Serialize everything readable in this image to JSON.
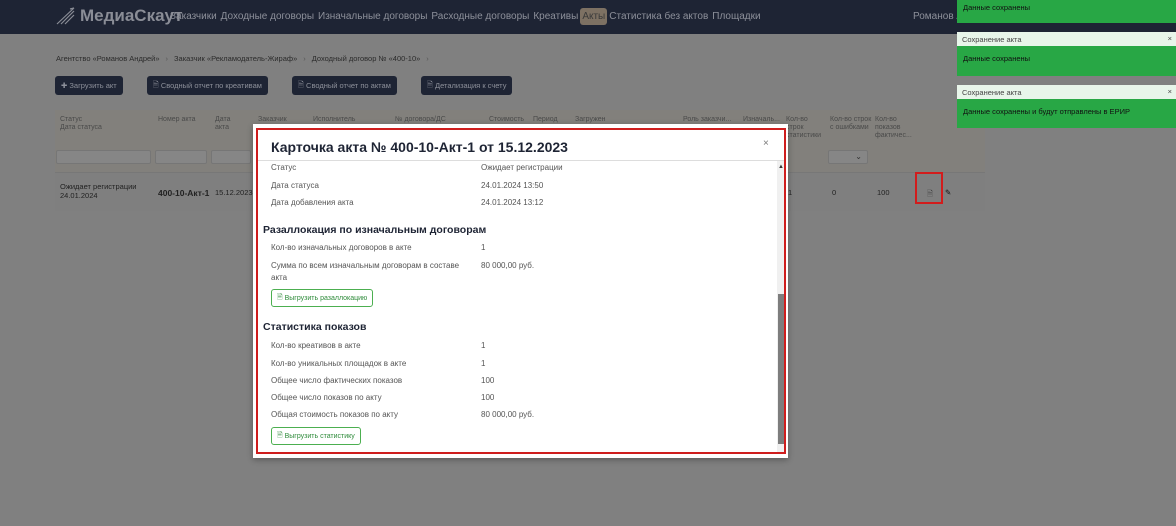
{
  "nav": {
    "brand": "МедиаСкаут",
    "items": [
      "Заказчики",
      "Доходные договоры",
      "Изначальные договоры",
      "Расходные договоры",
      "Креативы",
      "Акты",
      "Статистика без актов",
      "Площадки"
    ],
    "active": "Акты",
    "user": "Романов А"
  },
  "breadcrumb": [
    "Агентство «Романов Андрей»",
    "Заказчик «Рекламодатель-Жираф»",
    "Доходный договор № «400-10»"
  ],
  "toolbar": {
    "upload": "Загрузить акт",
    "report_creatives": "Сводный отчет по креативам",
    "report_acts": "Сводный отчет по актам",
    "detail": "Детализация к счету"
  },
  "table": {
    "headers": [
      "Статус\nДата статуса",
      "Номер акта",
      "Дата акта",
      "Заказчик",
      "Исполнитель",
      "№ договора/ДС",
      "Стоимость",
      "Период",
      "Загружен",
      "Роль заказчи...",
      "Изначаль...",
      "Кол-во строк статистики",
      "Кол-во строк с ошибками",
      "Кол-во показов фактичес..."
    ],
    "row": {
      "status": "Ожидает регистрации",
      "status_date": "24.01.2024",
      "number": "400-10-Акт-1",
      "date": "15.12.2023",
      "rows_stat": "1",
      "rows_errors": "0",
      "shows": "100"
    }
  },
  "modal": {
    "title": "Карточка акта № 400-10-Акт-1 от 15.12.2023",
    "close": "×",
    "general": [
      {
        "k": "Статус",
        "v": "Ожидает регистрации"
      },
      {
        "k": "Дата статуса",
        "v": "24.01.2024 13:50"
      },
      {
        "k": "Дата добавления акта",
        "v": "24.01.2024 13:12"
      }
    ],
    "realloc": {
      "title": "Разаллокация по изначальным договорам",
      "items": [
        {
          "k": "Кол-во изначальных договоров в акте",
          "v": "1"
        },
        {
          "k": "Сумма по всем изначальным договорам в составе акта",
          "v": "80 000,00 руб."
        }
      ],
      "button": "Выгрузить разаллокацию"
    },
    "stats": {
      "title": "Статистика показов",
      "items": [
        {
          "k": "Кол-во креативов в акте",
          "v": "1"
        },
        {
          "k": "Кол-во уникальных площадок в акте",
          "v": "1"
        },
        {
          "k": "Общее число фактических показов",
          "v": "100"
        },
        {
          "k": "Общее число показов по акту",
          "v": "100"
        },
        {
          "k": "Общая стоимость показов по акту",
          "v": "80 000,00 руб."
        }
      ],
      "button": "Выгрузить статистику"
    }
  },
  "toasts": [
    {
      "body": "Данные сохранены"
    },
    {
      "title": "Сохранение акта",
      "body": "Данные сохранены"
    },
    {
      "title": "Сохранение акта",
      "body": "Данные сохранены и будут отправлены в ЕРИР"
    }
  ]
}
